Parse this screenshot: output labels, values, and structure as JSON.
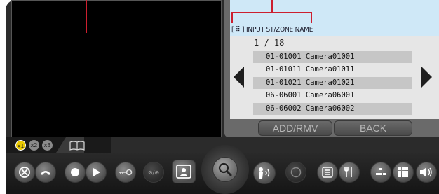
{
  "zone_panel": {
    "label": "[ ⠿ ] INPUT ST/ZONE NAME",
    "page_counter": "1 / 18",
    "cameras": [
      "01-01001 Camera01001",
      "01-01011 Camera01011",
      "01-01021 Camera01021",
      "06-06001 Camera06001",
      "06-06002 Camera06002"
    ],
    "add_rmv_label": "ADD/RMV",
    "back_label": "BACK"
  },
  "zoom": {
    "x1": "x1",
    "x2": "x2",
    "x3": "x3"
  },
  "toolbar": {
    "key_label": "⊸",
    "alt_label": "⊘/⊛"
  },
  "colors": {
    "callout": "#cc1f2f",
    "name_box": "#cfe8f7",
    "list_bg": "#e6e6e6",
    "row_highlight": "#c6c6c6",
    "zoom_active": "#e8c800"
  }
}
